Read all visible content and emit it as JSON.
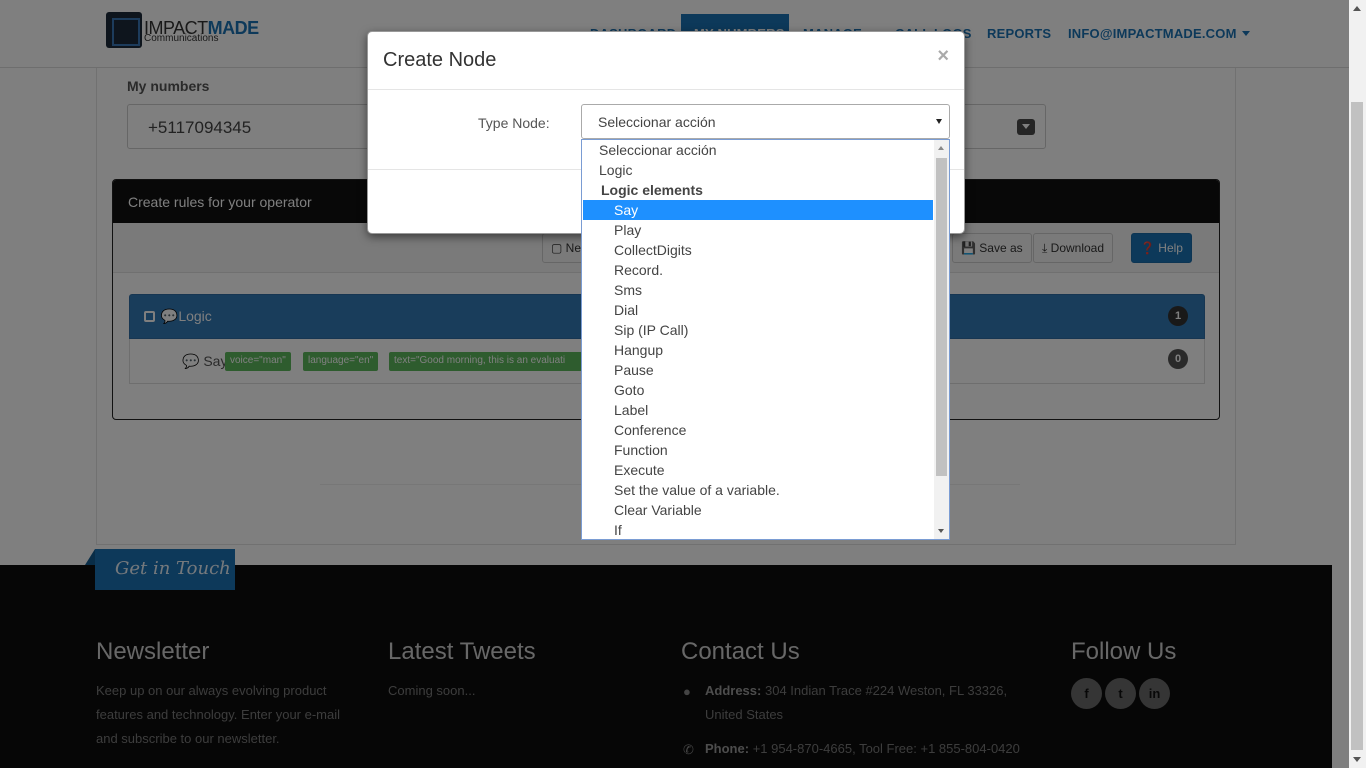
{
  "brand": {
    "name_part1": "IMPACT",
    "name_part2": "MADE",
    "sub": "Communications"
  },
  "nav": {
    "items": [
      "DASHBOARD",
      "MY NUMBERS",
      "MANAGE",
      "CALL LOGS",
      "REPORTS"
    ],
    "account": "INFO@IMPACTMADE.COM"
  },
  "mynumbers": {
    "label": "My numbers",
    "value": "+5117094345"
  },
  "rules": {
    "title": "Create rules for your operator",
    "toolbar": {
      "new": "Ne",
      "save_as": "Save as",
      "download": "Download",
      "help": "Help"
    },
    "logic": {
      "label": "Logic",
      "count": "1"
    },
    "say": {
      "label": "Say",
      "tags": [
        "voice=\"man\"",
        "language=\"en\"",
        "text=\"Good morning, this is an evaluati"
      ],
      "count": "0"
    }
  },
  "modal": {
    "title": "Create Node",
    "close": "×",
    "type_label": "Type Node:",
    "selected": "Seleccionar acción",
    "options": [
      {
        "label": "Seleccionar acción",
        "kind": "top"
      },
      {
        "label": "Logic",
        "kind": "top"
      },
      {
        "label": "Logic elements",
        "kind": "group"
      },
      {
        "label": "Say",
        "kind": "child",
        "selected": true
      },
      {
        "label": "Play",
        "kind": "child"
      },
      {
        "label": "CollectDigits",
        "kind": "child"
      },
      {
        "label": "Record.",
        "kind": "child"
      },
      {
        "label": "Sms",
        "kind": "child"
      },
      {
        "label": "Dial",
        "kind": "child"
      },
      {
        "label": "Sip (IP Call)",
        "kind": "child"
      },
      {
        "label": "Hangup",
        "kind": "child"
      },
      {
        "label": "Pause",
        "kind": "child"
      },
      {
        "label": "Goto",
        "kind": "child"
      },
      {
        "label": "Label",
        "kind": "child"
      },
      {
        "label": "Conference",
        "kind": "child"
      },
      {
        "label": "Function",
        "kind": "child"
      },
      {
        "label": "Execute",
        "kind": "child"
      },
      {
        "label": "Set the value of a variable.",
        "kind": "child"
      },
      {
        "label": "Clear Variable",
        "kind": "child"
      },
      {
        "label": "If",
        "kind": "child"
      }
    ]
  },
  "footer": {
    "get_in_touch": "Get in Touch",
    "newsletter": {
      "title": "Newsletter",
      "text": [
        "Keep up on our always evolving product",
        "features and technology. Enter your e-mail",
        "and subscribe to our newsletter."
      ]
    },
    "tweets": {
      "title": "Latest Tweets",
      "text": "Coming soon..."
    },
    "contact": {
      "title": "Contact Us",
      "address_label": "Address:",
      "address": "304 Indian Trace #224 Weston, FL 33326,",
      "address2": "United States",
      "phone_label": "Phone:",
      "phone": "+1 954-870-4665, Tool Free: +1 855-804-0420"
    },
    "follow": {
      "title": "Follow Us",
      "icons": [
        "facebook-icon",
        "twitter-icon",
        "linkedin-icon"
      ]
    }
  }
}
